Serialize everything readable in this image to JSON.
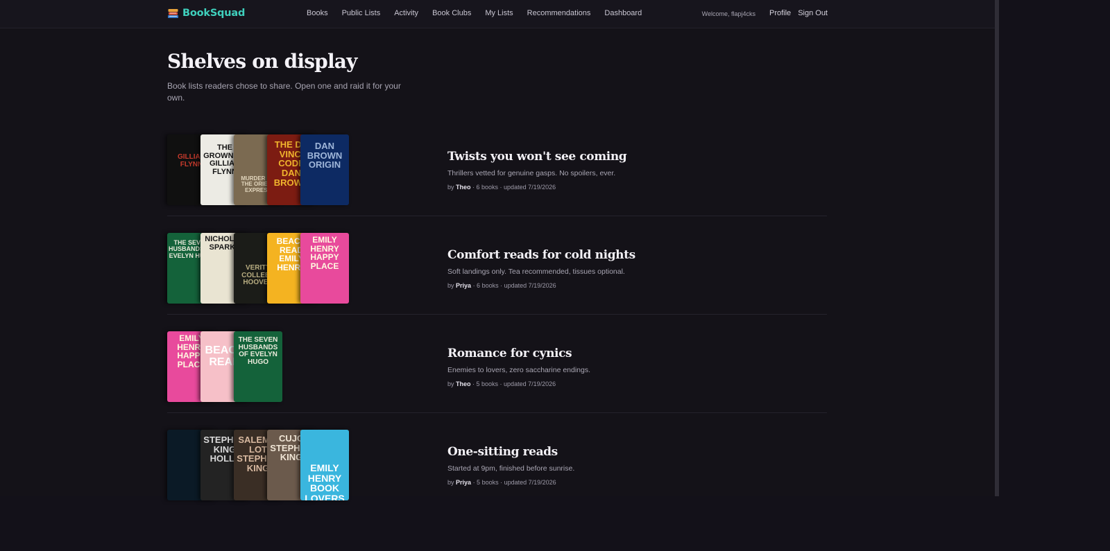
{
  "app": {
    "brand": "BookSquad",
    "brand_icon": "books-stack-icon",
    "accent": "#3fd0bd"
  },
  "nav": {
    "links": [
      "Books",
      "Public Lists",
      "Activity",
      "Book Clubs",
      "My Lists",
      "Recommendations",
      "Dashboard"
    ],
    "welcome": "Welcome, flapj4cks",
    "profile": "Profile",
    "sign_out": "Sign Out"
  },
  "page": {
    "title": "Shelves on display",
    "subtitle": "Book lists readers chose to share. Open one and raid it for your own."
  },
  "lists": [
    {
      "title": "Twists you won't see coming",
      "description": "Thrillers vetted for genuine gasps. No spoilers, ever.",
      "by": "by",
      "author": "Theo",
      "meta": " · 6 books · updated 7/19/2026",
      "covers": [
        {
          "text": "GILLIAN FLYNN",
          "bg": "#101010",
          "fg": "#c73a2c"
        },
        {
          "text": "THE GROWN UP GILLIAN FLYNN",
          "bg": "#ecebe4",
          "fg": "#141414"
        },
        {
          "text": "MURDER ON THE ORIENT EXPRESS",
          "bg": "#7b6a51",
          "fg": "#e2d6bd"
        },
        {
          "text": "THE DA VINCI CODE DAN BROWN",
          "bg": "#7c1c12",
          "fg": "#f0b52d"
        },
        {
          "text": "DAN BROWN ORIGIN",
          "bg": "#0d2a63",
          "fg": "#9fb6d9"
        }
      ]
    },
    {
      "title": "Comfort reads for cold nights",
      "description": "Soft landings only. Tea recommended, tissues optional.",
      "by": "by",
      "author": "Priya",
      "meta": " · 6 books · updated 7/19/2026",
      "covers": [
        {
          "text": "THE SEVEN HUSBANDS OF EVELYN HUGO",
          "bg": "#14623a",
          "fg": "#eaeadb"
        },
        {
          "text": "NICHOLAS SPARKS",
          "bg": "#e9e4d2",
          "fg": "#1a1a1a"
        },
        {
          "text": "VERITY COLLEEN HOOVER",
          "bg": "#1b1c18",
          "fg": "#b7ac80"
        },
        {
          "text": "BEACH READ EMILY HENRY",
          "bg": "#f4b321",
          "fg": "#ffffff"
        },
        {
          "text": "EMILY HENRY HAPPY PLACE",
          "bg": "#e84a9c",
          "fg": "#fffbe0"
        }
      ]
    },
    {
      "title": "Romance for cynics",
      "description": "Enemies to lovers, zero saccharine endings.",
      "by": "by",
      "author": "Theo",
      "meta": " · 5 books · updated 7/19/2026",
      "covers": [
        {
          "text": "EMILY HENRY HAPPY PLACE",
          "bg": "#e84a9c",
          "fg": "#fffbe0"
        },
        {
          "text": "BEACH READ",
          "bg": "#f6c0c8",
          "fg": "#ffffff"
        },
        {
          "text": "THE SEVEN HUSBANDS OF EVELYN HUGO",
          "bg": "#14623a",
          "fg": "#eaeadb"
        }
      ]
    },
    {
      "title": "One-sitting reads",
      "description": "Started at 9pm, finished before sunrise.",
      "by": "by",
      "author": "Priya",
      "meta": " · 5 books · updated 7/19/2026",
      "covers": [
        {
          "text": "",
          "bg": "#0b1a26",
          "fg": "#5fb7d8"
        },
        {
          "text": "STEPHEN KING HOLLY",
          "bg": "#232323",
          "fg": "#d9d9d9"
        },
        {
          "text": "SALEM'S LOT STEPHEN KING",
          "bg": "#3a2e25",
          "fg": "#d8b9a0"
        },
        {
          "text": "CUJO STEPHEN KING",
          "bg": "#6b5a4c",
          "fg": "#f1e6d6"
        },
        {
          "text": "EMILY HENRY BOOK LOVERS",
          "bg": "#3ab6de",
          "fg": "#ffffff"
        }
      ]
    }
  ]
}
